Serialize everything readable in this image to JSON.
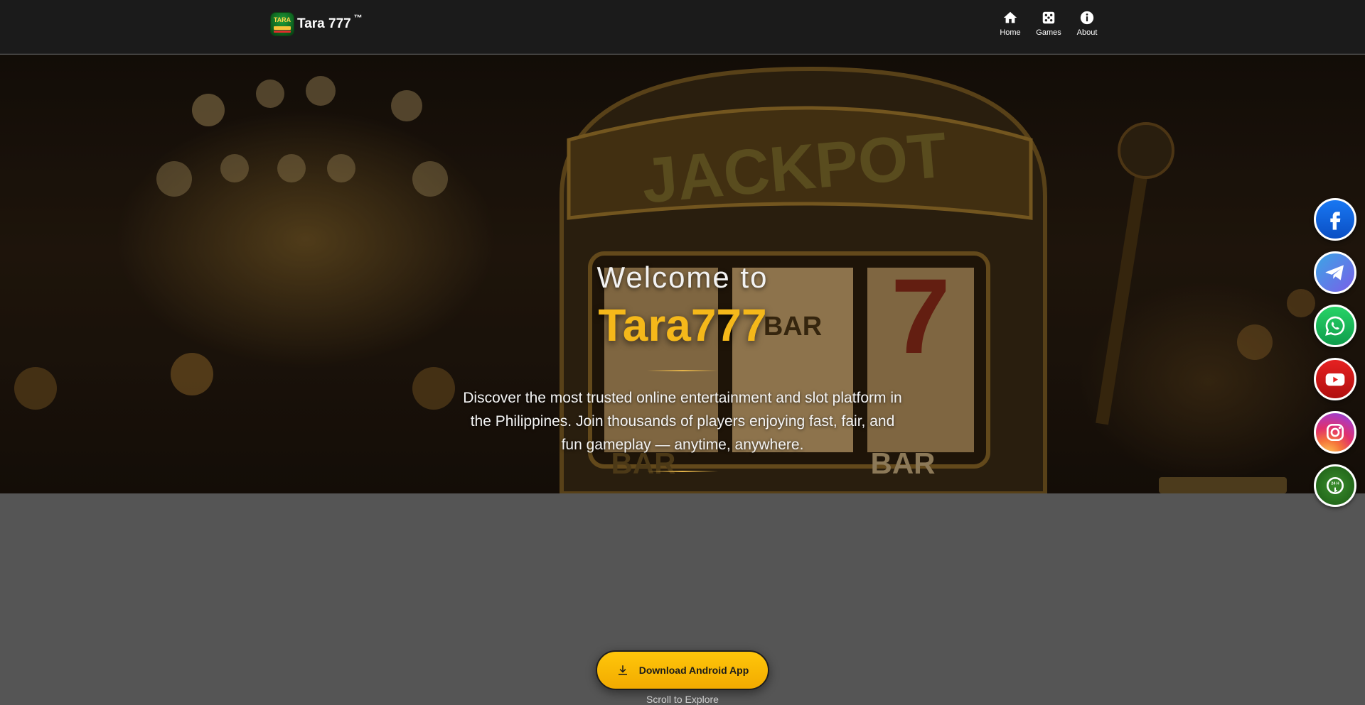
{
  "header": {
    "brand_logo_text": "TARA",
    "brand_name": "Tara 777",
    "brand_tm": "™",
    "nav": [
      {
        "label": "Home",
        "icon": "home-icon"
      },
      {
        "label": "Games",
        "icon": "dice-icon"
      },
      {
        "label": "About",
        "icon": "info-icon"
      }
    ]
  },
  "hero": {
    "welcome": "Welcome to",
    "title": "Tara777",
    "description": "Discover the most trusted online entertainment and slot platform in the Philippines. Join thousands of players enjoying fast, fair, and fun gameplay — anytime, anywhere.",
    "background_image_text": [
      "JACKPOT",
      "BAR",
      "7",
      "BAR",
      "BAR"
    ]
  },
  "social": [
    {
      "name": "facebook-icon",
      "color": "#1877f2"
    },
    {
      "name": "telegram-icon",
      "color": "#3ba6e6"
    },
    {
      "name": "whatsapp-icon",
      "color": "#27d366"
    },
    {
      "name": "youtube-icon",
      "color": "#e52121"
    },
    {
      "name": "instagram-icon",
      "color": "#e1306c"
    },
    {
      "name": "support-24h-icon",
      "color": "#3a8d2d",
      "label": "24 H"
    }
  ],
  "cta": {
    "download_label": "Download Android App",
    "scroll_hint": "Scroll to Explore"
  },
  "colors": {
    "accent_gold": "#f5b81a",
    "button_yellow": "#ffc60a",
    "header_bg": "#1b1b1b",
    "page_bg": "#555555"
  }
}
